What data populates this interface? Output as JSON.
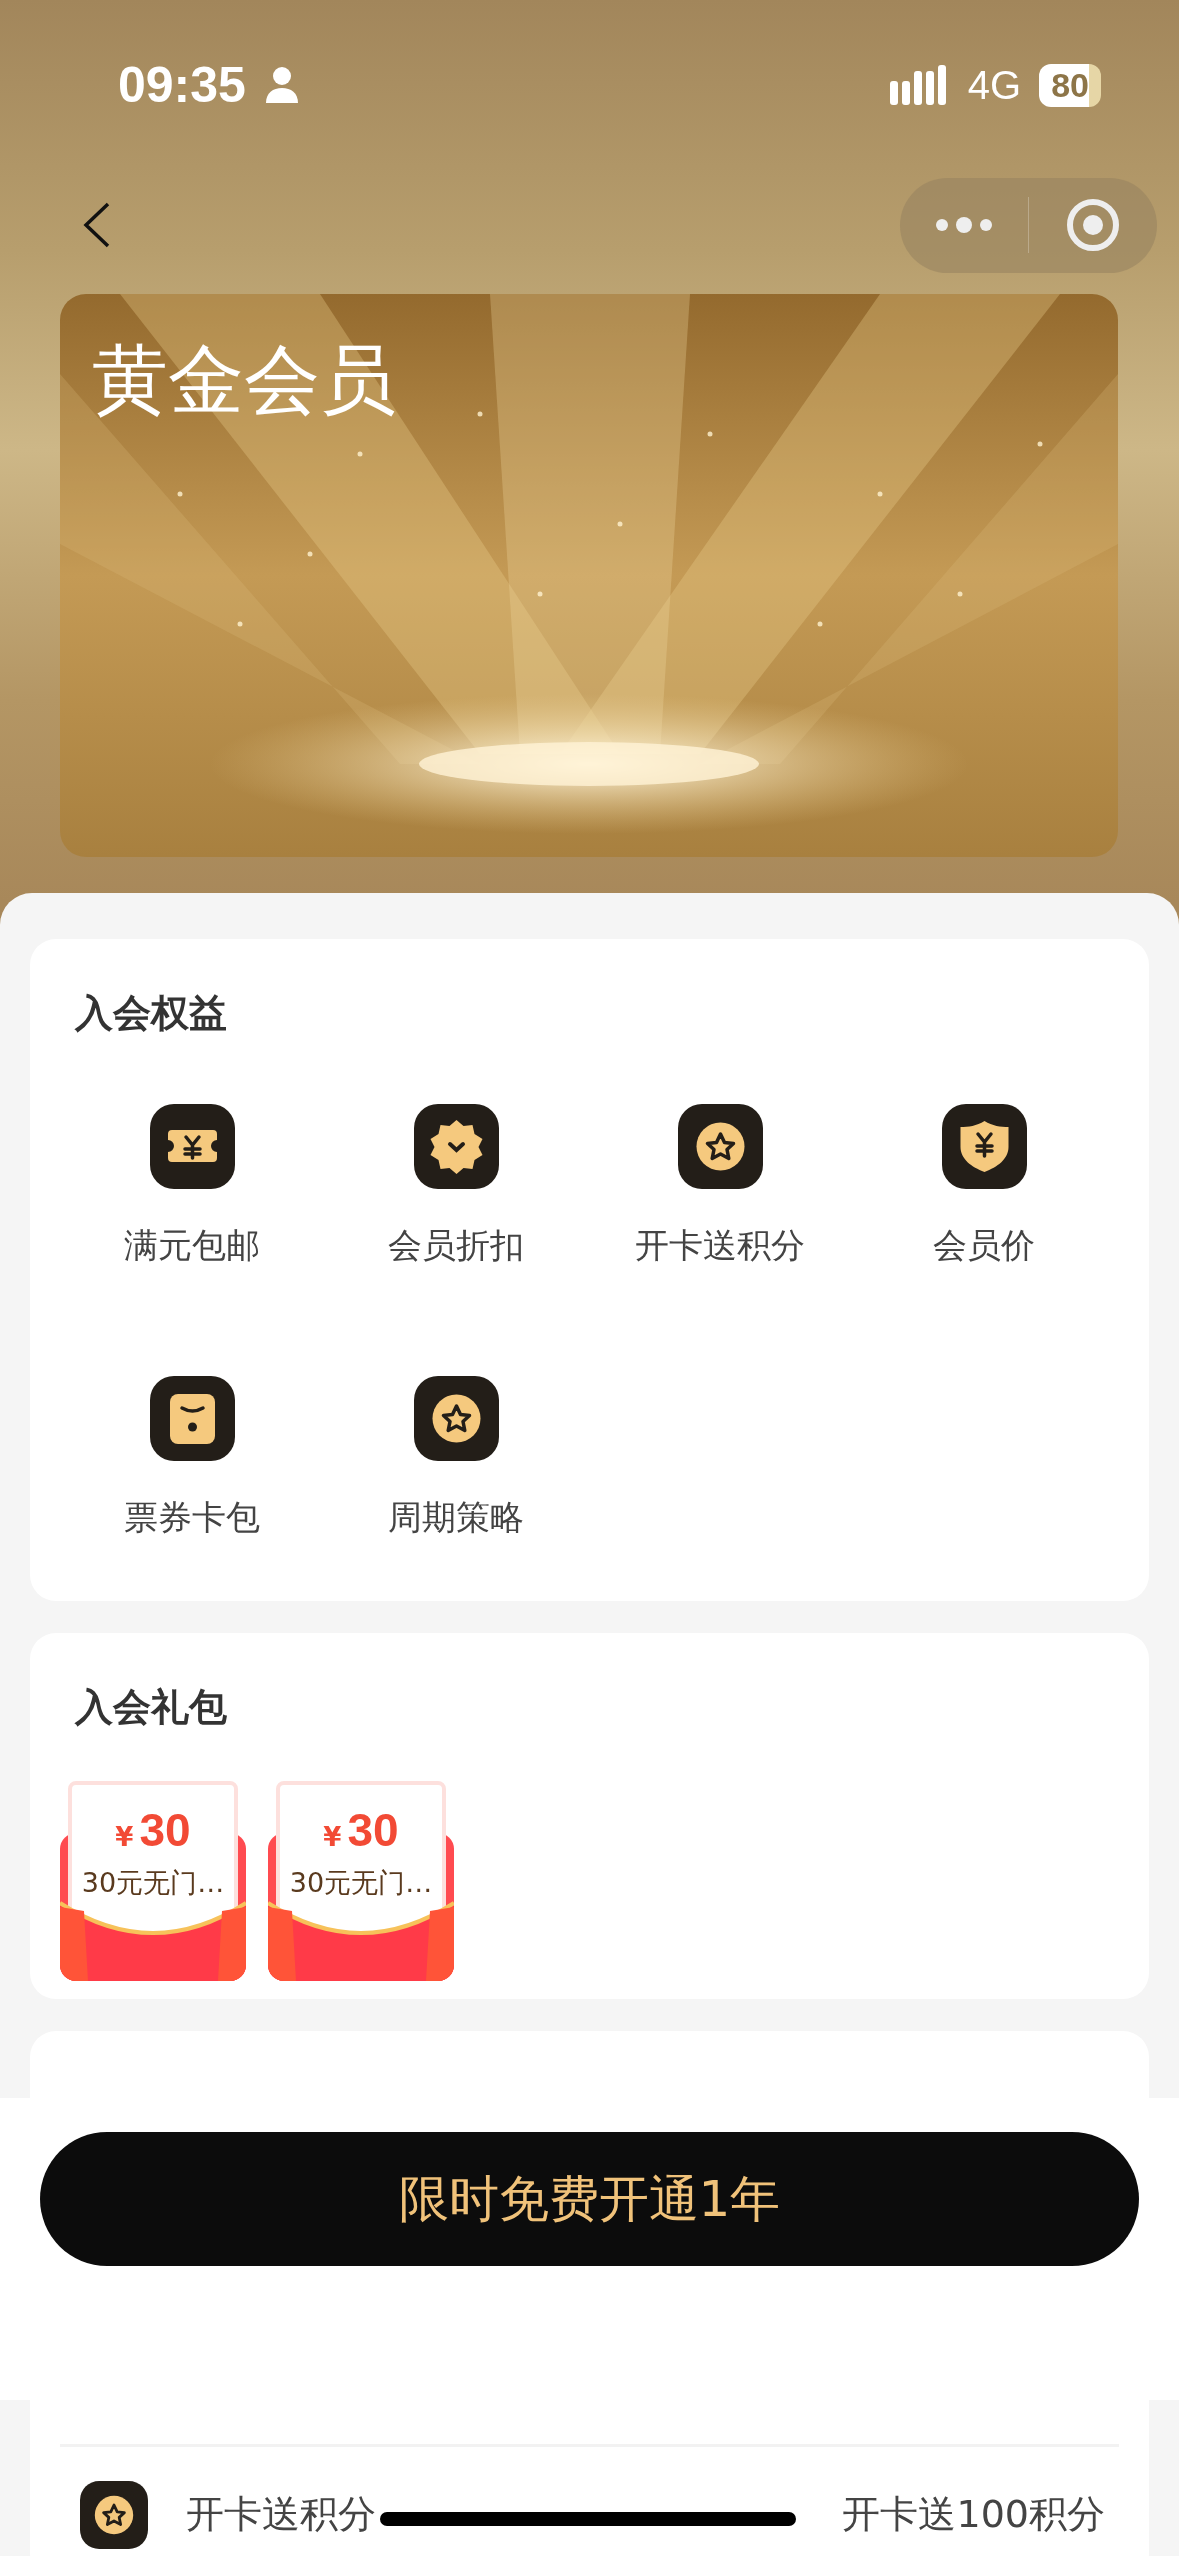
{
  "status_bar": {
    "time": "09:35",
    "network": "4G",
    "battery": "80"
  },
  "member_card": {
    "title": "黄金会员"
  },
  "benefits": {
    "title": "入会权益",
    "items": [
      {
        "label": "满元包邮",
        "kind": "ticket"
      },
      {
        "label": "会员折扣",
        "kind": "badge"
      },
      {
        "label": "开卡送积分",
        "kind": "star"
      },
      {
        "label": "会员价",
        "kind": "shield"
      },
      {
        "label": "票券卡包",
        "kind": "wallet"
      },
      {
        "label": "周期策略",
        "kind": "star"
      }
    ]
  },
  "gift_pack": {
    "title": "入会礼包",
    "coupons": [
      {
        "currency": "¥",
        "amount": "30",
        "name": "30元无门…"
      },
      {
        "currency": "¥",
        "amount": "30",
        "name": "30元无门…"
      }
    ]
  },
  "order_benefits": {
    "rows": [
      {
        "label": "开卡送积分",
        "value": "开卡送100积分",
        "kind": "star"
      }
    ]
  },
  "action_button": {
    "label": "限时免费开通1年"
  }
}
